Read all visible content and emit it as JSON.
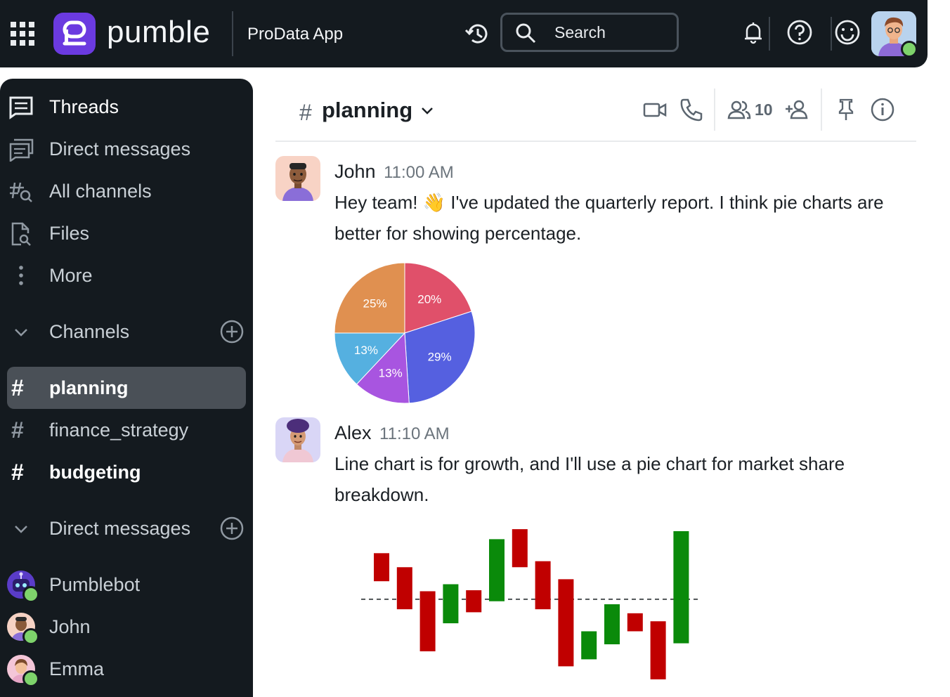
{
  "topbar": {
    "brand": "pumble",
    "workspace": "ProData App",
    "search_placeholder": "Search"
  },
  "sidebar": {
    "nav": [
      {
        "label": "Threads",
        "icon": "threads-icon"
      },
      {
        "label": "Direct messages",
        "icon": "direct-messages-icon"
      },
      {
        "label": "All channels",
        "icon": "all-channels-icon"
      },
      {
        "label": "Files",
        "icon": "files-icon"
      },
      {
        "label": "More",
        "icon": "more-icon"
      }
    ],
    "channels_section": "Channels",
    "channels": [
      {
        "name": "planning",
        "active": true
      },
      {
        "name": "finance_strategy",
        "active": false
      },
      {
        "name": "budgeting",
        "active": false,
        "unread": true
      }
    ],
    "dm_section": "Direct messages",
    "dms": [
      {
        "name": "Pumblebot",
        "status": "online"
      },
      {
        "name": "John",
        "status": "online"
      },
      {
        "name": "Emma",
        "status": "online"
      }
    ]
  },
  "channel": {
    "hash": "#",
    "name": "planning",
    "member_count": "10"
  },
  "messages": [
    {
      "author": "John",
      "time": "11:00 AM",
      "text": "Hey team! 👋 I've updated the quarterly report. I think pie charts are better for showing percentage."
    },
    {
      "author": "Alex",
      "time": "11:10 AM",
      "text": "Line chart is for growth, and I'll use a pie chart for market share breakdown."
    }
  ],
  "colors": {
    "topbar_bg": "#141a1f",
    "brand_purple": "#6b3ae0",
    "active_channel_bg": "#4a5057",
    "online": "#7ed36b",
    "up_bar": "#0a8a0a",
    "down_bar": "#c00000"
  },
  "chart_data": [
    {
      "type": "pie",
      "slices": [
        {
          "label": "20%",
          "value": 20,
          "color": "#e0506a"
        },
        {
          "label": "29%",
          "value": 29,
          "color": "#5560e0"
        },
        {
          "label": "13%",
          "value": 13,
          "color": "#a855e0"
        },
        {
          "label": "13%",
          "value": 13,
          "color": "#55b0e0"
        },
        {
          "label": "25%",
          "value": 25,
          "color": "#e09050"
        }
      ]
    },
    {
      "type": "bar",
      "subtype": "floating-waterfall",
      "baseline": 0,
      "baseline_style": "dashed",
      "ylim": [
        -6.5,
        6.5
      ],
      "bars": [
        {
          "low": 1.8,
          "high": 4.6,
          "direction": "down"
        },
        {
          "low": -1.0,
          "high": 3.2,
          "direction": "down"
        },
        {
          "low": -5.2,
          "high": 0.8,
          "direction": "down"
        },
        {
          "low": -2.4,
          "high": 1.5,
          "direction": "up"
        },
        {
          "low": -1.3,
          "high": 0.9,
          "direction": "down"
        },
        {
          "low": -0.2,
          "high": 6.0,
          "direction": "up"
        },
        {
          "low": 3.2,
          "high": 7.0,
          "direction": "down"
        },
        {
          "low": -1.0,
          "high": 3.8,
          "direction": "down"
        },
        {
          "low": -6.7,
          "high": 2.0,
          "direction": "down"
        },
        {
          "low": -6.0,
          "high": -3.2,
          "direction": "up"
        },
        {
          "low": -4.5,
          "high": -0.5,
          "direction": "up"
        },
        {
          "low": -3.2,
          "high": -1.4,
          "direction": "down"
        },
        {
          "low": -8.0,
          "high": -2.2,
          "direction": "down"
        },
        {
          "low": -4.4,
          "high": 6.8,
          "direction": "up"
        }
      ]
    }
  ]
}
